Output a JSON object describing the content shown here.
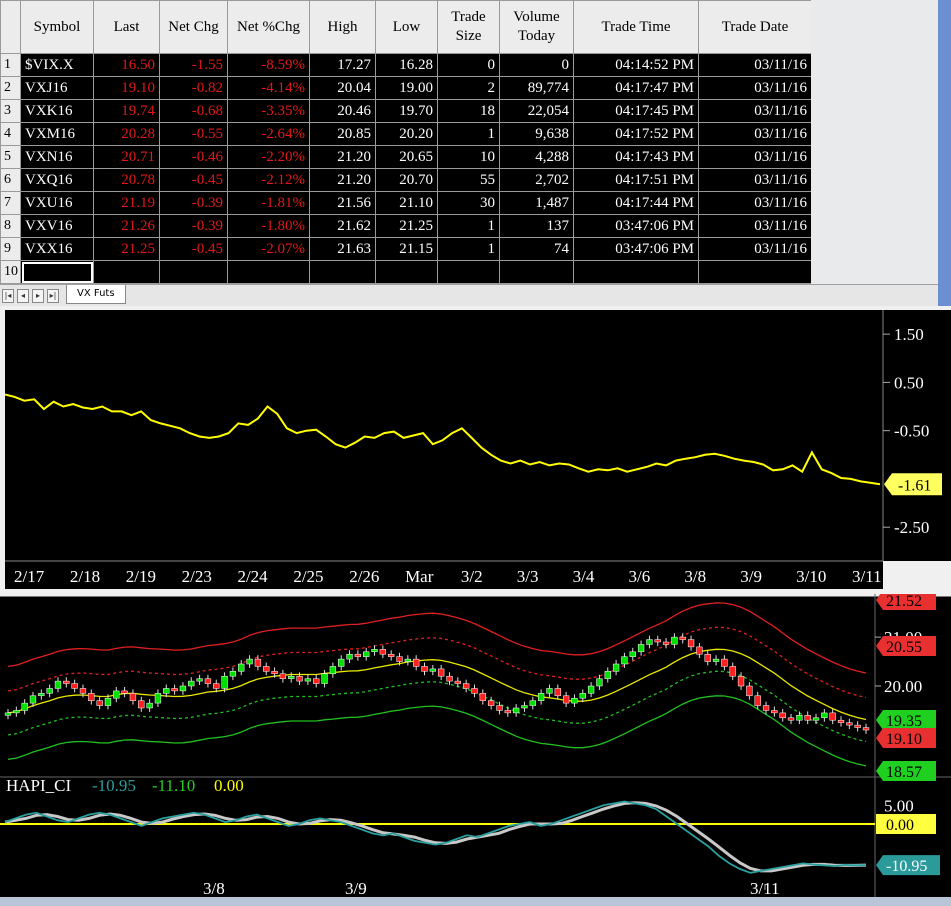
{
  "sheet": {
    "headers": [
      "Symbol",
      "Last",
      "Net Chg",
      "Net %Chg",
      "High",
      "Low",
      "Trade|Size",
      "Volume|Today",
      "Trade Time",
      "Trade Date"
    ],
    "row_numbers": [
      "1",
      "2",
      "3",
      "4",
      "5",
      "6",
      "7",
      "8",
      "9",
      "10"
    ],
    "rows": [
      [
        "$VIX.X",
        "16.50",
        "-1.55",
        "-8.59%",
        "17.27",
        "16.28",
        "0",
        "0",
        "04:14:52 PM",
        "03/11/16"
      ],
      [
        "VXJ16",
        "19.10",
        "-0.82",
        "-4.14%",
        "20.04",
        "19.00",
        "2",
        "89,774",
        "04:17:47 PM",
        "03/11/16"
      ],
      [
        "VXK16",
        "19.74",
        "-0.68",
        "-3.35%",
        "20.46",
        "19.70",
        "18",
        "22,054",
        "04:17:45 PM",
        "03/11/16"
      ],
      [
        "VXM16",
        "20.28",
        "-0.55",
        "-2.64%",
        "20.85",
        "20.20",
        "1",
        "9,638",
        "04:17:52 PM",
        "03/11/16"
      ],
      [
        "VXN16",
        "20.71",
        "-0.46",
        "-2.20%",
        "21.20",
        "20.65",
        "10",
        "4,288",
        "04:17:43 PM",
        "03/11/16"
      ],
      [
        "VXQ16",
        "20.78",
        "-0.45",
        "-2.12%",
        "21.20",
        "20.70",
        "55",
        "2,702",
        "04:17:51 PM",
        "03/11/16"
      ],
      [
        "VXU16",
        "21.19",
        "-0.39",
        "-1.81%",
        "21.56",
        "21.10",
        "30",
        "1,487",
        "04:17:44 PM",
        "03/11/16"
      ],
      [
        "VXV16",
        "21.26",
        "-0.39",
        "-1.80%",
        "21.62",
        "21.25",
        "1",
        "137",
        "03:47:06 PM",
        "03/11/16"
      ],
      [
        "VXX16",
        "21.25",
        "-0.45",
        "-2.07%",
        "21.63",
        "21.15",
        "1",
        "74",
        "03:47:06 PM",
        "03/11/16"
      ]
    ],
    "tab_label": "VX Futs",
    "nav_glyphs": [
      "|◂",
      "◂",
      "▸",
      "▸|"
    ]
  },
  "colors": {
    "neg": "#e01818",
    "line": "#ffff00",
    "upper_band": "#e02020",
    "lower_band": "#20c020",
    "mid_band": "#e8e800",
    "osc_teal": "#2aa0a0",
    "osc_gray": "#c8c8c8",
    "up_candle": "#00e000",
    "down_candle": "#ff2020"
  },
  "chart_data": [
    {
      "type": "line",
      "name": "spread",
      "x_ticks": [
        "2/17",
        "2/18",
        "2/19",
        "2/23",
        "2/24",
        "2/25",
        "2/26",
        "Mar",
        "3/2",
        "3/3",
        "3/4",
        "3/6",
        "3/8",
        "3/9",
        "3/10",
        "3/11"
      ],
      "y_ticks": [
        "1.50",
        "0.50",
        "-0.50",
        "-2.50"
      ],
      "ylim": [
        -3.2,
        2.0
      ],
      "last_value_label": "-1.61",
      "values": [
        0.25,
        0.2,
        0.12,
        0.15,
        -0.05,
        0.1,
        0.0,
        0.05,
        -0.02,
        -0.05,
        0.0,
        -0.1,
        -0.1,
        -0.18,
        -0.1,
        -0.28,
        -0.35,
        -0.4,
        -0.45,
        -0.55,
        -0.62,
        -0.65,
        -0.62,
        -0.55,
        -0.35,
        -0.38,
        -0.25,
        0.0,
        -0.15,
        -0.45,
        -0.55,
        -0.5,
        -0.48,
        -0.62,
        -0.78,
        -0.85,
        -0.75,
        -0.62,
        -0.65,
        -0.55,
        -0.52,
        -0.65,
        -0.6,
        -0.55,
        -0.78,
        -0.7,
        -0.55,
        -0.45,
        -0.65,
        -0.85,
        -1.0,
        -1.12,
        -1.18,
        -1.12,
        -1.2,
        -1.15,
        -1.22,
        -1.18,
        -1.2,
        -1.28,
        -1.35,
        -1.3,
        -1.32,
        -1.28,
        -1.35,
        -1.3,
        -1.25,
        -1.18,
        -1.22,
        -1.12,
        -1.08,
        -1.05,
        -1.0,
        -0.98,
        -1.02,
        -1.08,
        -1.12,
        -1.15,
        -1.2,
        -1.32,
        -1.3,
        -1.22,
        -1.35,
        -0.95,
        -1.3,
        -1.38,
        -1.48,
        -1.5,
        -1.55,
        -1.58,
        -1.61
      ]
    },
    {
      "type": "candlestick",
      "name": "VXJ16",
      "y_ticks": [
        "21.00",
        "20.00"
      ],
      "ylim": [
        18.2,
        21.8
      ],
      "band_labels": {
        "upper": "21.52",
        "upper_inner": "20.55",
        "lower_inner": "19.35",
        "last": "19.10",
        "lower": "18.57"
      },
      "closes": [
        19.45,
        19.5,
        19.65,
        19.8,
        19.85,
        19.95,
        20.1,
        20.05,
        19.95,
        19.85,
        19.7,
        19.6,
        19.75,
        19.9,
        19.85,
        19.7,
        19.55,
        19.65,
        19.85,
        19.95,
        19.9,
        20.0,
        20.1,
        20.15,
        20.05,
        19.95,
        20.2,
        20.3,
        20.45,
        20.55,
        20.4,
        20.3,
        20.25,
        20.15,
        20.2,
        20.1,
        20.15,
        20.05,
        20.25,
        20.4,
        20.55,
        20.65,
        20.6,
        20.7,
        20.75,
        20.65,
        20.6,
        20.5,
        20.55,
        20.4,
        20.3,
        20.35,
        20.2,
        20.1,
        20.05,
        19.95,
        19.85,
        19.7,
        19.6,
        19.5,
        19.45,
        19.55,
        19.6,
        19.7,
        19.85,
        19.95,
        19.8,
        19.65,
        19.75,
        19.85,
        20.0,
        20.15,
        20.3,
        20.45,
        20.6,
        20.7,
        20.85,
        20.95,
        20.9,
        20.85,
        21.0,
        20.95,
        20.8,
        20.65,
        20.5,
        20.55,
        20.4,
        20.2,
        20.0,
        19.8,
        19.6,
        19.5,
        19.45,
        19.35,
        19.3,
        19.4,
        19.3,
        19.35,
        19.45,
        19.3,
        19.25,
        19.2,
        19.15,
        19.1
      ]
    },
    {
      "type": "line",
      "name": "HAPI_CI",
      "legend": [
        "HAPI_CI",
        "-10.95",
        "-11.10",
        "0.00"
      ],
      "y_ticks": [
        "5.00"
      ],
      "ylim": [
        -16,
        8
      ],
      "value_labels": {
        "zero": "0.00",
        "last": "-10.95"
      },
      "x_ticks": [
        "3/8",
        "3/9",
        "3/11"
      ],
      "values": [
        0.5,
        1.5,
        2.5,
        3.0,
        2.0,
        1.0,
        0.5,
        1.5,
        2.5,
        3.0,
        2.5,
        1.5,
        0.5,
        -0.5,
        0.5,
        1.5,
        2.0,
        2.5,
        3.0,
        2.5,
        1.5,
        0.5,
        1.0,
        2.0,
        2.5,
        1.5,
        0.5,
        -0.5,
        0.0,
        1.0,
        1.5,
        1.0,
        0.5,
        -0.5,
        -1.5,
        -2.5,
        -3.0,
        -2.5,
        -3.5,
        -4.5,
        -5.0,
        -5.5,
        -5.0,
        -4.0,
        -3.0,
        -3.5,
        -2.5,
        -1.5,
        -0.5,
        0.0,
        0.5,
        -0.5,
        0.0,
        1.0,
        2.0,
        3.0,
        4.0,
        5.0,
        5.5,
        6.0,
        5.5,
        5.0,
        4.0,
        2.0,
        0.0,
        -2.0,
        -4.0,
        -6.0,
        -8.5,
        -10.5,
        -12.0,
        -13.0,
        -12.5,
        -12.0,
        -11.5,
        -11.0,
        -10.5,
        -10.8,
        -11.0,
        -11.2,
        -10.9,
        -11.0,
        -10.95
      ]
    }
  ]
}
